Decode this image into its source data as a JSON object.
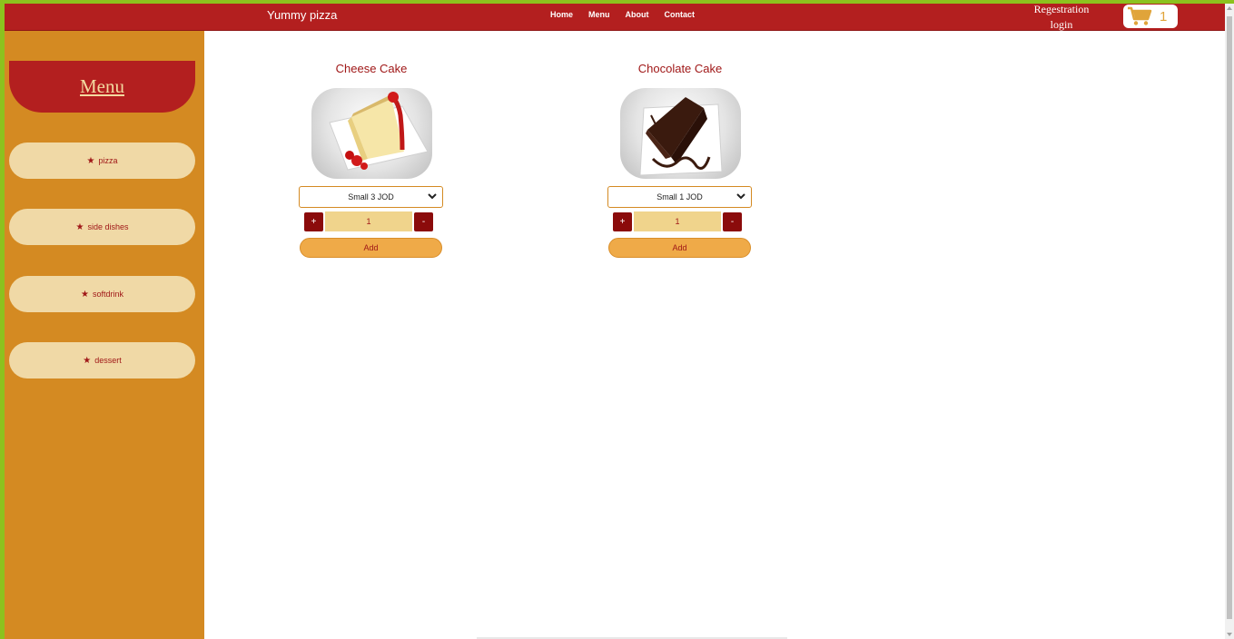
{
  "navbar": {
    "brand": "Yummy pizza",
    "links": [
      "Home",
      "Menu",
      "About",
      "Contact"
    ],
    "registration": "Regestration",
    "login": "login",
    "cart_count": "1",
    "cart_icon": "shopping-cart-icon"
  },
  "sidebar": {
    "title": "Menu",
    "categories": [
      "pizza",
      "side dishes",
      "softdrink",
      "dessert"
    ],
    "star": "★"
  },
  "products": [
    {
      "name": "Cheese Cake",
      "size_option": "Small 3 JOD",
      "quantity": "1",
      "plus": "+",
      "minus": "-",
      "add_label": "Add"
    },
    {
      "name": "Chocolate Cake",
      "size_option": "Small 1 JOD",
      "quantity": "1",
      "plus": "+",
      "minus": "-",
      "add_label": "Add"
    }
  ],
  "colors": {
    "header_red": "#b31f1f",
    "sidebar_orange": "#d48a22",
    "category_cream": "#f0d9a6",
    "accent_text": "#a01818",
    "add_button": "#efaa48",
    "frame_green": "#8cc21e"
  }
}
